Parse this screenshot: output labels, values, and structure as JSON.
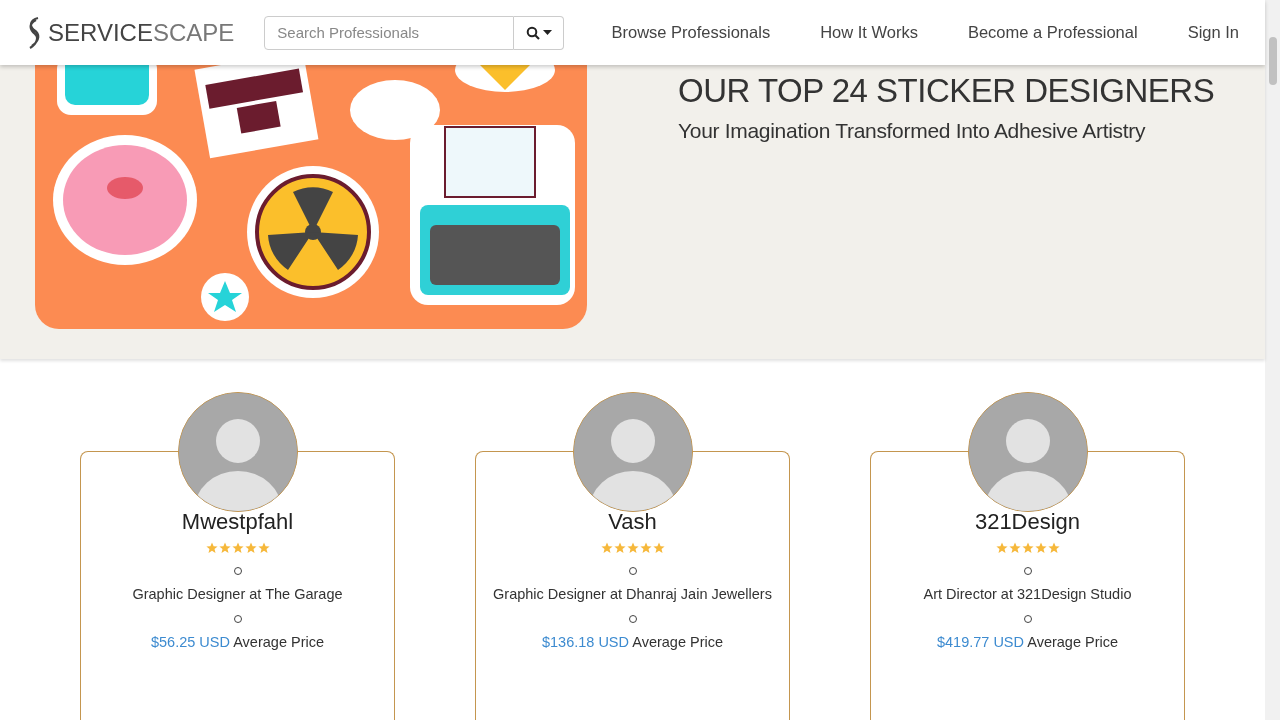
{
  "header": {
    "logo": {
      "text_dark": "SERVICE",
      "text_light": "SCAPE"
    },
    "search": {
      "placeholder": "Search Professionals"
    },
    "nav": [
      {
        "label": "Browse Professionals"
      },
      {
        "label": "How It Works"
      },
      {
        "label": "Become a Professional"
      },
      {
        "label": "Sign In"
      }
    ]
  },
  "hero": {
    "title": "OUR TOP 24 STICKER DESIGNERS",
    "subtitle": "Your Imagination Transformed Into Adhesive Artistry"
  },
  "professionals": [
    {
      "name": "Mwestpfahl",
      "stars": 5,
      "role": "Graphic Designer at The Garage",
      "price": "$56.25 USD",
      "price_label": "Average Price"
    },
    {
      "name": "Vash",
      "stars": 5,
      "role": "Graphic Designer at Dhanraj Jain Jewellers",
      "price": "$136.18 USD",
      "price_label": "Average Price"
    },
    {
      "name": "321Design",
      "stars": 5,
      "role": "Art Director at 321Design Studio",
      "price": "$419.77 USD",
      "price_label": "Average Price"
    }
  ]
}
